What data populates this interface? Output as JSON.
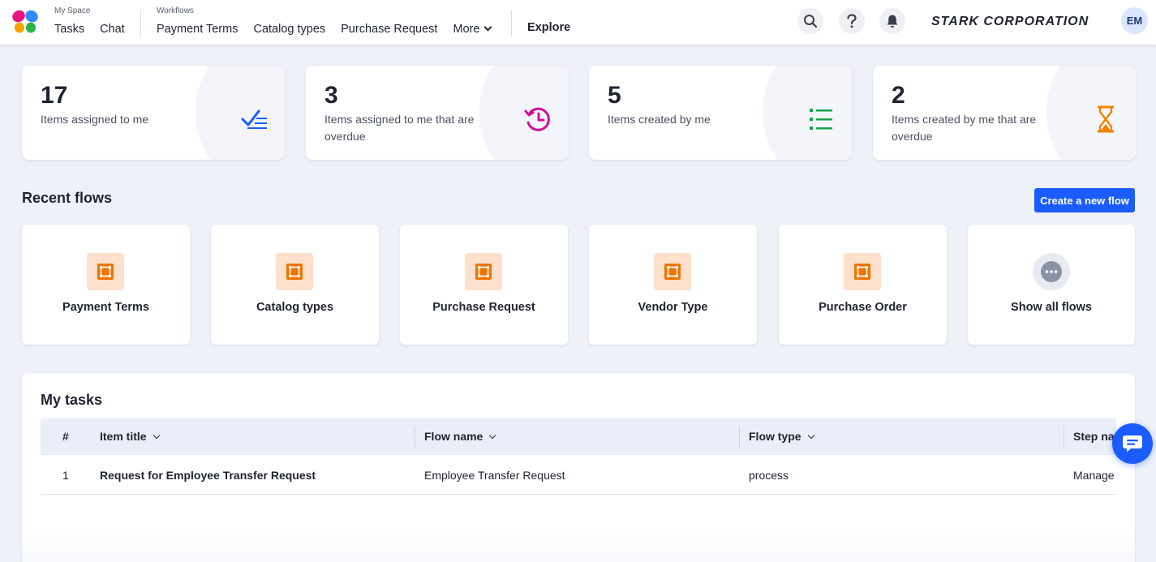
{
  "nav": {
    "my_space_caption": "My Space",
    "my_space_items": [
      "Tasks",
      "Chat"
    ],
    "workflows_caption": "Workflows",
    "workflow_items": [
      "Payment Terms",
      "Catalog types",
      "Purchase Request"
    ],
    "more_label": "More",
    "explore_label": "Explore",
    "icons": [
      "search-icon",
      "help-icon",
      "bell-icon"
    ],
    "brand": "STARK CORPORATION",
    "avatar_initials": "EM"
  },
  "stats": [
    {
      "value": "17",
      "label": "Items assigned to me",
      "icon": "checklist-icon",
      "color": "#1a5cff"
    },
    {
      "value": "3",
      "label": "Items assigned to me that are overdue",
      "icon": "history-icon",
      "color": "#d10f9a"
    },
    {
      "value": "5",
      "label": "Items created by me",
      "icon": "list-icon",
      "color": "#17a34a"
    },
    {
      "value": "2",
      "label": "Items created by me that are overdue",
      "icon": "hourglass-icon",
      "color": "#f08400"
    }
  ],
  "recent_flows": {
    "title": "Recent flows",
    "create_button": "Create a new flow",
    "items": [
      "Payment Terms",
      "Catalog types",
      "Purchase Request",
      "Vendor Type",
      "Purchase Order"
    ],
    "show_all": "Show all flows"
  },
  "my_tasks": {
    "title": "My tasks",
    "columns": [
      "#",
      "Item title",
      "Flow name",
      "Flow type",
      "Step na"
    ],
    "rows": [
      {
        "num": "1",
        "item_title": "Request for Employee Transfer Request",
        "flow_name": "Employee Transfer Request",
        "flow_type": "process",
        "step_name": "Manage"
      }
    ]
  },
  "colors": {
    "accent": "#1a5cff",
    "background": "#eef1f8",
    "flow_icon_bg": "#ffe0cc",
    "flow_icon": "#f07400"
  }
}
